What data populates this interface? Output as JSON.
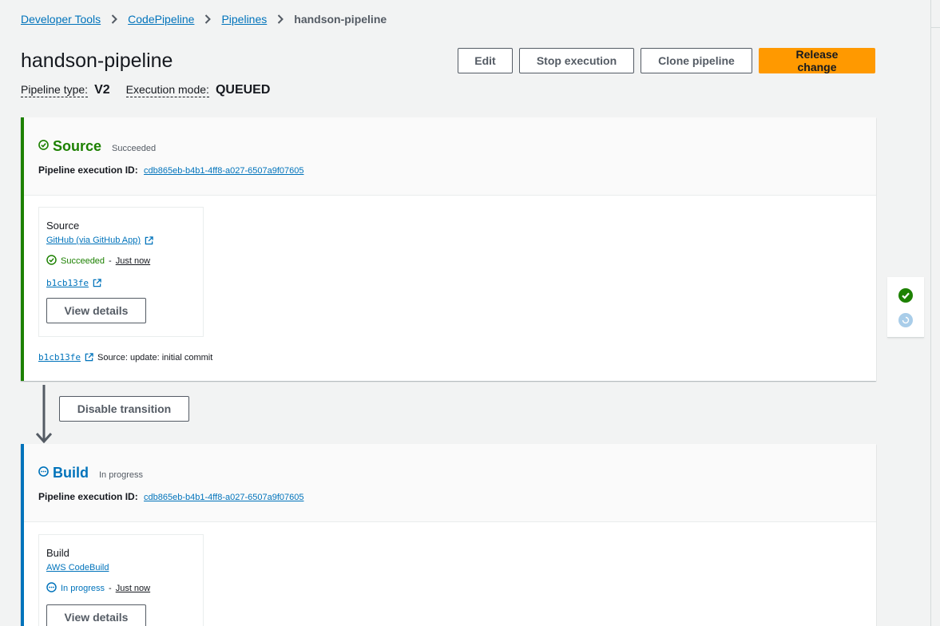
{
  "breadcrumb": {
    "items": [
      "Developer Tools",
      "CodePipeline",
      "Pipelines"
    ],
    "current": "handson-pipeline"
  },
  "header": {
    "title": "handson-pipeline",
    "pipeline_type_label": "Pipeline type:",
    "pipeline_type_value": "V2",
    "execution_mode_label": "Execution mode:",
    "execution_mode_value": "QUEUED"
  },
  "actions": {
    "edit": "Edit",
    "stop": "Stop execution",
    "clone": "Clone pipeline",
    "release": "Release change"
  },
  "colors": {
    "success": "#1d8102",
    "in_progress": "#0073bb",
    "primary": "#ff9900",
    "link": "#0073bb"
  },
  "stages": {
    "source": {
      "name": "Source",
      "status": "Succeeded",
      "exec_label": "Pipeline execution ID:",
      "exec_id": "cdb865eb-b4b1-4ff8-a027-6507a9f07605",
      "action": {
        "name": "Source",
        "provider": "GitHub (via GitHub App)",
        "status": "Succeeded",
        "separator": "-",
        "time": "Just now",
        "commit": "b1cb13fe",
        "view_details": "View details"
      },
      "footer": {
        "commit": "b1cb13fe",
        "message": "Source: update: initial commit"
      }
    },
    "transition": {
      "label": "Disable transition"
    },
    "build": {
      "name": "Build",
      "status": "In progress",
      "exec_label": "Pipeline execution ID:",
      "exec_id": "cdb865eb-b4b1-4ff8-a027-6507a9f07605",
      "action": {
        "name": "Build",
        "provider": "AWS CodeBuild",
        "status": "In progress",
        "separator": "-",
        "time": "Just now",
        "view_details": "View details"
      }
    }
  },
  "icons": {
    "success": "check-circle-icon",
    "in_progress": "ellipsis-circle-icon",
    "external": "external-link-icon",
    "chevron": "chevron-right-icon"
  }
}
